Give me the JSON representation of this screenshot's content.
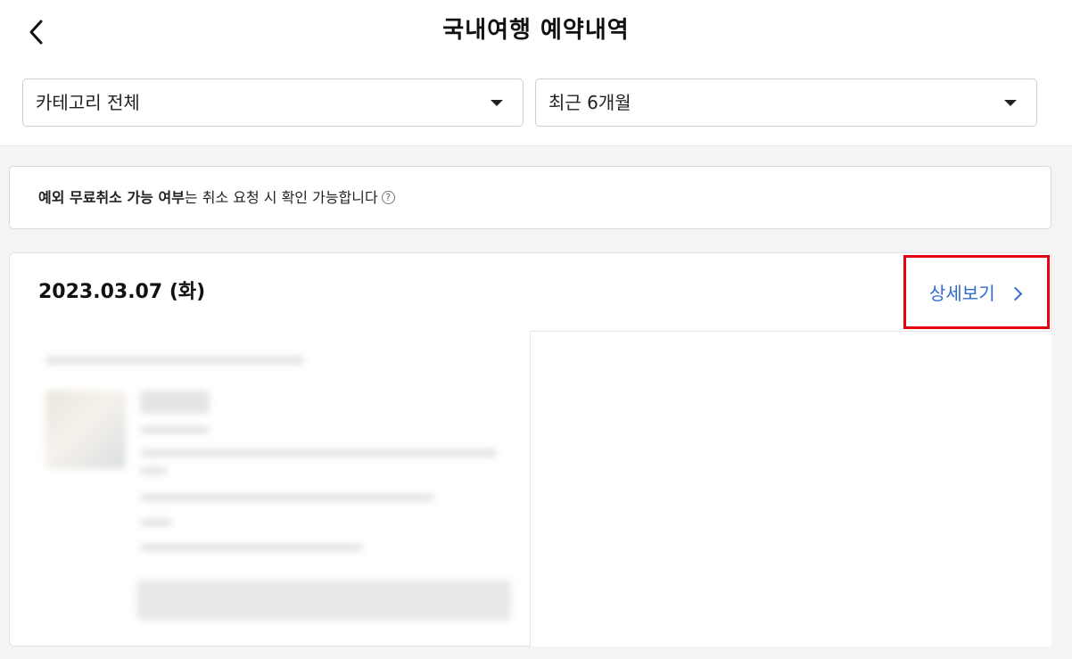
{
  "header": {
    "title": "국내여행 예약내역",
    "back_icon": "chevron-left-icon"
  },
  "filters": {
    "category": {
      "selected": "카테고리 전체"
    },
    "period": {
      "selected": "최근 6개월"
    }
  },
  "notice": {
    "bold_text": "예외 무료취소 가능 여부",
    "rest_text": "는 취소 요청 시 확인 가능합니다",
    "help_icon": "?"
  },
  "order": {
    "date": "2023.03.07 (화)",
    "detail_label": "상세보기"
  },
  "colors": {
    "link": "#2f6bd0",
    "highlight_border": "#e60012"
  }
}
